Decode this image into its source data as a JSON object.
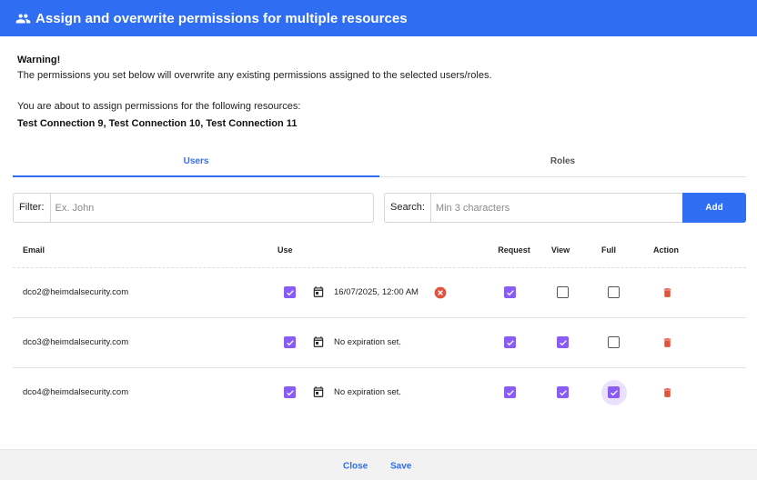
{
  "dialog": {
    "title": "Assign and overwrite permissions for multiple resources",
    "header_color": "#2f6ef2",
    "icon": "users-group-icon"
  },
  "warning": {
    "title": "Warning!",
    "text": "The permissions you set below will overwrite any existing permissions assigned to the selected users/roles."
  },
  "resources": {
    "intro": "You are about to assign permissions for the following resources:",
    "list": "Test Connection 9, Test Connection 10, Test Connection 11"
  },
  "tabs": [
    {
      "label": "Users",
      "active": true
    },
    {
      "label": "Roles",
      "active": false
    }
  ],
  "filter": {
    "label": "Filter:",
    "placeholder": "Ex. John",
    "value": ""
  },
  "search": {
    "label": "Search:",
    "placeholder": "Min 3 characters",
    "value": "",
    "add_label": "Add"
  },
  "table": {
    "headers": {
      "email": "Email",
      "use": "Use",
      "request": "Request",
      "view": "View",
      "full": "Full",
      "action": "Action"
    },
    "rows": [
      {
        "email": "dco2@heimdalsecurity.com",
        "use": true,
        "expiration": "16/07/2025, 12:00 AM",
        "has_expiration": true,
        "request": true,
        "view": false,
        "full": false
      },
      {
        "email": "dco3@heimdalsecurity.com",
        "use": true,
        "expiration": "No expiration set.",
        "has_expiration": false,
        "request": true,
        "view": true,
        "full": false
      },
      {
        "email": "dco4@heimdalsecurity.com",
        "use": true,
        "expiration": "No expiration set.",
        "has_expiration": false,
        "request": true,
        "view": true,
        "full": true,
        "full_focused": true
      }
    ]
  },
  "footer": {
    "close_label": "Close",
    "save_label": "Save"
  },
  "colors": {
    "accent": "#2f6ef2",
    "checkbox": "#8a5cf6",
    "delete": "#e0533f",
    "clear": "#e0533f"
  }
}
